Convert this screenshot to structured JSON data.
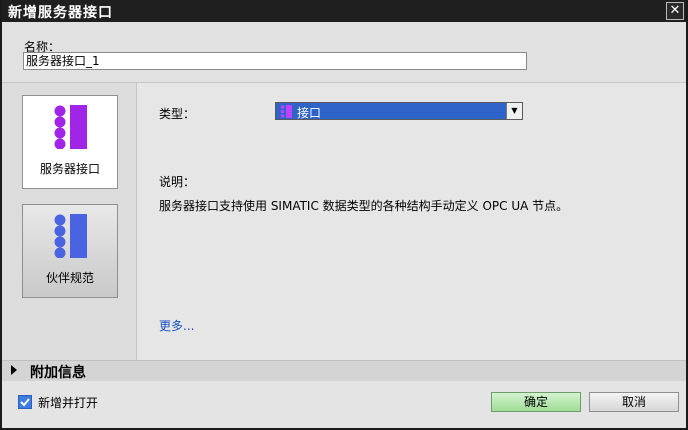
{
  "window": {
    "title": "新增服务器接口"
  },
  "name_field": {
    "label": "名称：",
    "value": "服务器接口_1"
  },
  "types": [
    {
      "label": "服务器接口",
      "icon": "server-interface-icon",
      "selected": true
    },
    {
      "label": "伙伴规范",
      "icon": "companion-spec-icon",
      "selected": false
    }
  ],
  "details": {
    "type_label": "类型：",
    "type_value": "接口",
    "description_label": "说明：",
    "description": "服务器接口支持使用 SIMATIC 数据类型的各种结构手动定义 OPC UA 节点。",
    "more_link": "更多..."
  },
  "additional_info": {
    "label": "附加信息"
  },
  "footer": {
    "checkbox_label": "新增并打开",
    "checkbox_checked": true,
    "ok_label": "确定",
    "cancel_label": "取消"
  },
  "colors": {
    "select_bg": "#2e63c8",
    "server_icon": "#a025e6",
    "partner_icon": "#4a63e0",
    "ok_button": "#a8e0a0"
  }
}
